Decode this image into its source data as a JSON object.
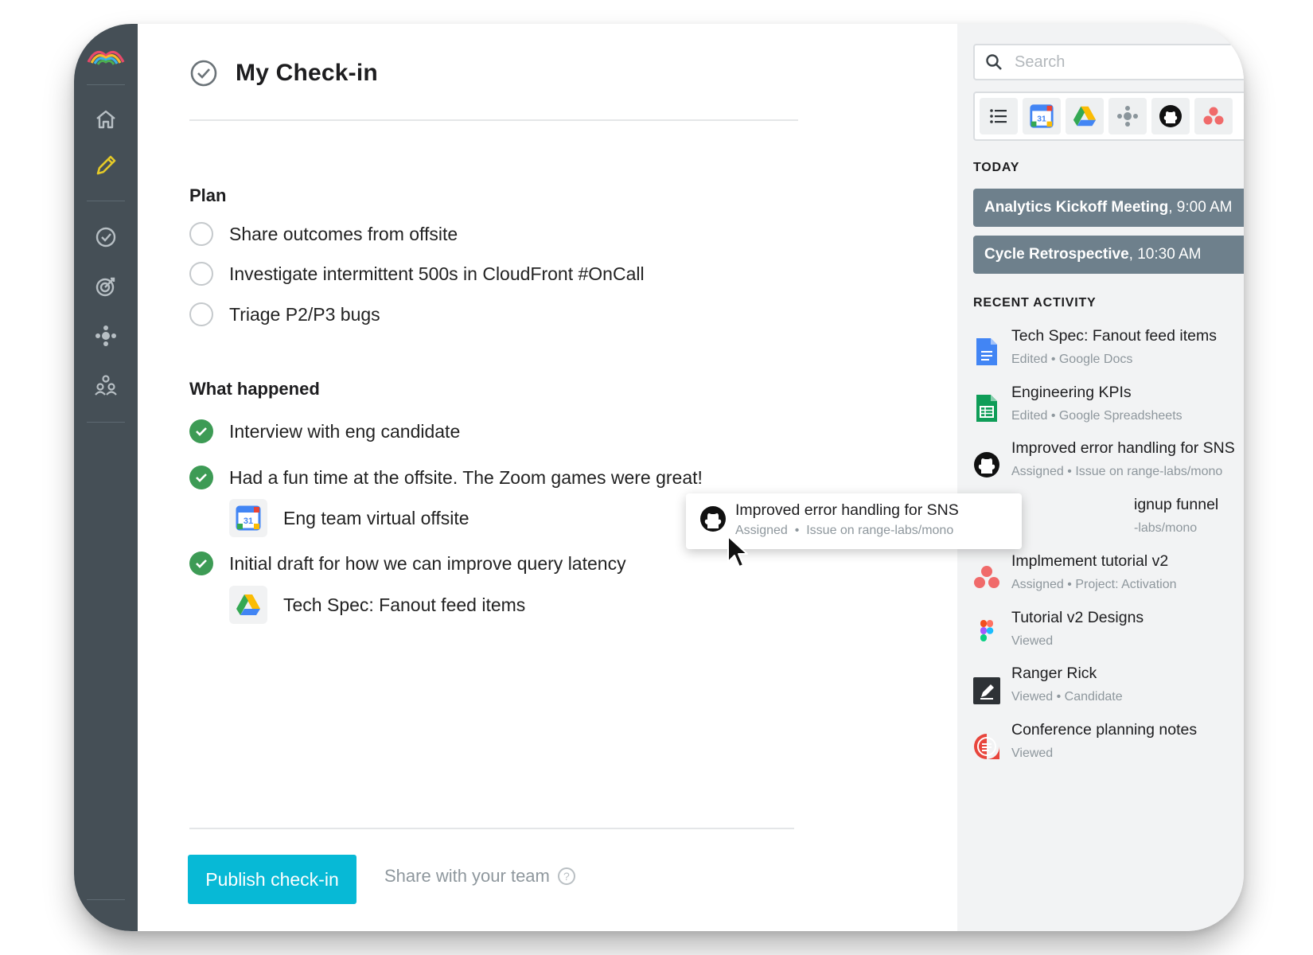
{
  "header": {
    "title": "My Check-in"
  },
  "plan": {
    "title": "Plan",
    "items": [
      {
        "label": "Share outcomes from offsite"
      },
      {
        "label": "Investigate intermittent 500s in CloudFront #OnCall"
      },
      {
        "label": "Triage P2/P3 bugs"
      }
    ]
  },
  "happened": {
    "title": "What happened",
    "items": [
      {
        "label": "Interview with eng candidate"
      },
      {
        "label": "Had a fun time at the offsite. The Zoom games were great!",
        "attachment": "Eng team virtual offsite",
        "attachment_icon": "google-calendar-icon"
      },
      {
        "label": "Initial draft for how we can improve query latency",
        "attachment": "Tech Spec: Fanout feed items",
        "attachment_icon": "google-drive-icon"
      }
    ]
  },
  "footer": {
    "publish_label": "Publish check-in",
    "share_label": "Share with your team",
    "help_glyph": "?"
  },
  "sidebar": {
    "icons": [
      "logo-rainbow-icon",
      "home-icon",
      "pencil-icon",
      "check-circle-icon",
      "target-icon",
      "team-hub-icon",
      "people-icon"
    ]
  },
  "panel": {
    "search_placeholder": "Search",
    "filters": [
      "list-icon",
      "google-calendar-icon",
      "google-drive-icon",
      "team-hub-icon",
      "github-icon",
      "asana-icon"
    ],
    "today_heading": "TODAY",
    "events": [
      {
        "name": "Analytics Kickoff Meeting",
        "time": ", 9:00 AM"
      },
      {
        "name": "Cycle Retrospective",
        "time": ", 10:30 AM"
      }
    ],
    "recent_heading": "RECENT ACTIVITY",
    "activities": [
      {
        "title": "Tech Spec: Fanout feed items",
        "meta": "Edited • Google Docs",
        "icon": "google-docs-icon"
      },
      {
        "title": "Engineering KPIs",
        "meta": "Edited • Google Spreadsheets",
        "icon": "google-sheets-icon"
      },
      {
        "title": "Improved error handling for SNS",
        "meta": "Assigned • Issue on range-labs/mono",
        "icon": "github-icon"
      },
      {
        "title": "ignup funnel",
        "meta": "-labs/mono",
        "icon": "github-icon"
      },
      {
        "title": "Implmement tutorial v2",
        "meta": "Assigned • Project: Activation",
        "icon": "asana-icon"
      },
      {
        "title": "Tutorial v2 Designs",
        "meta": "Viewed",
        "icon": "figma-icon"
      },
      {
        "title": "Ranger Rick",
        "meta": "Viewed • Candidate",
        "icon": "greenhouse-icon"
      },
      {
        "title": "Conference planning notes",
        "meta": "Viewed",
        "icon": "quip-icon"
      }
    ]
  },
  "drag_card": {
    "title": "Improved error handling for SNS",
    "meta_status": "Assigned",
    "meta_sep": "•",
    "meta_detail": "Issue on range-labs/mono"
  },
  "colors": {
    "rail": "#454f56",
    "accent": "#07b9d6",
    "done": "#3d9b55",
    "event": "#6e808c",
    "pencil": "#e4c928"
  }
}
